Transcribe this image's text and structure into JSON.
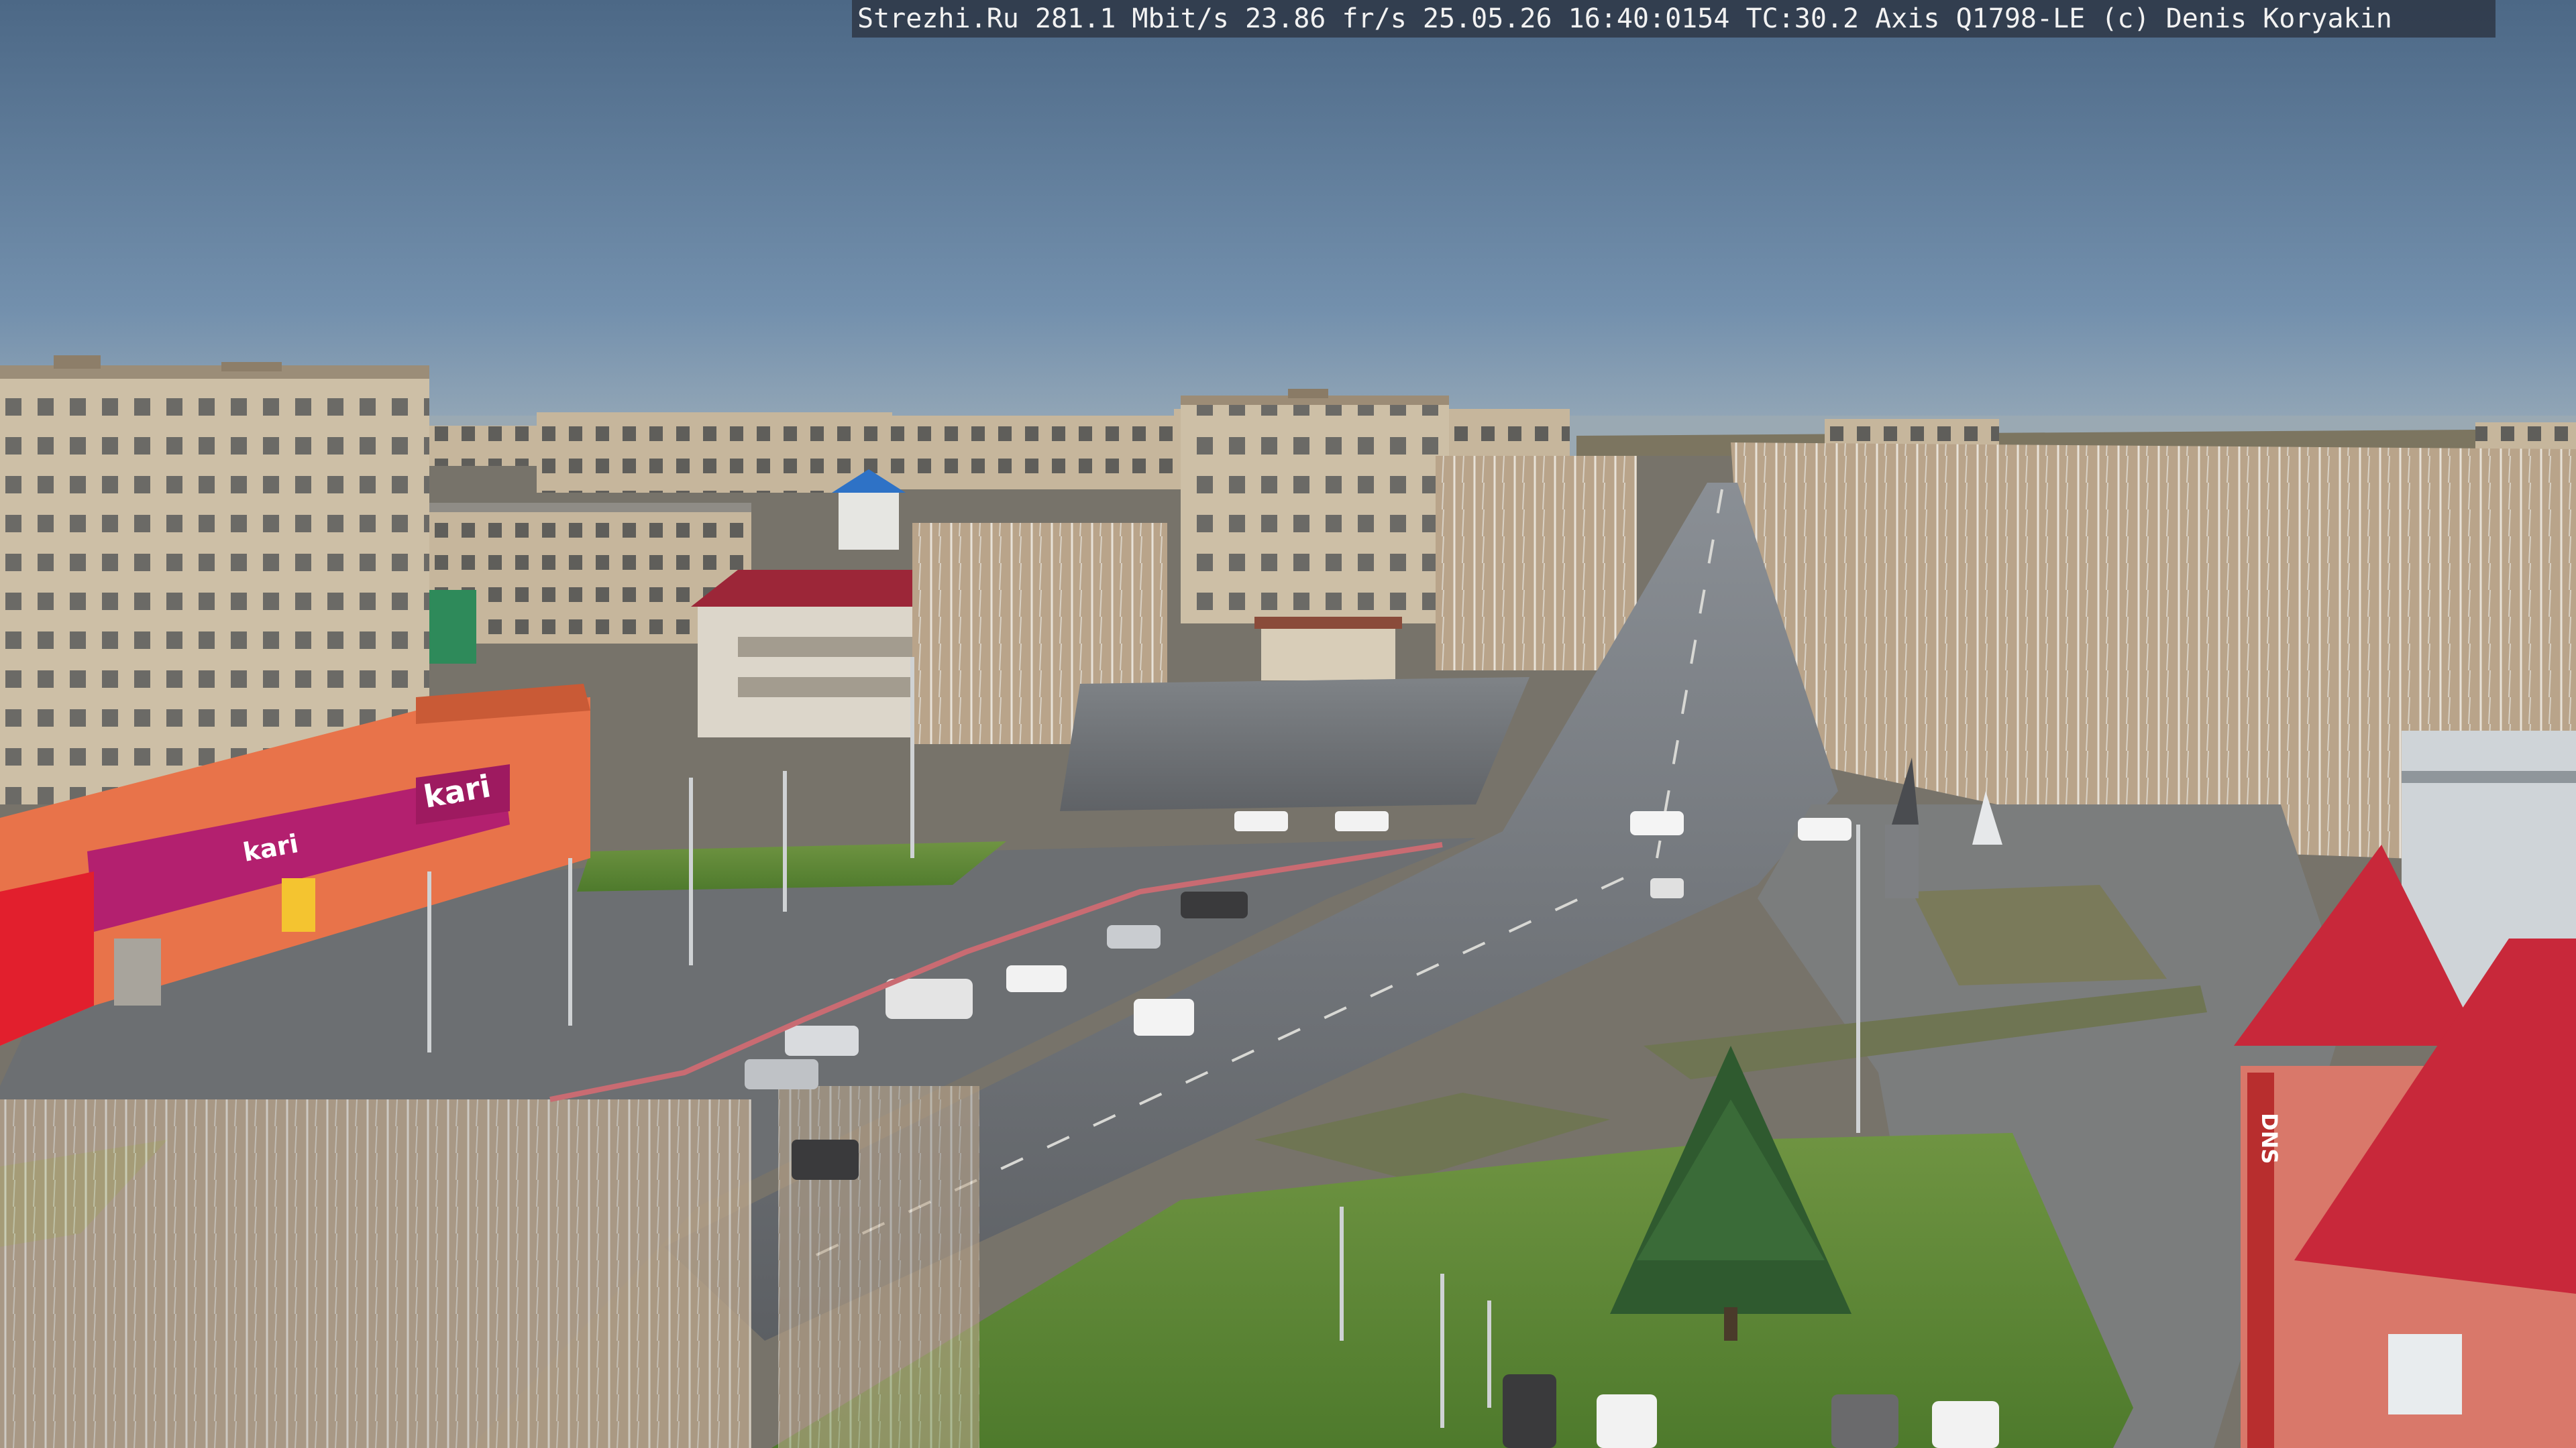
{
  "camera_overlay": {
    "text": "Strezhi.Ru 281.1 Mbit/s 23.86 fr/s 25.05.26 16:40:0154 TC:30.2  Axis Q1798-LE  (c) Denis Koryakin"
  },
  "storefront_signs": {
    "kari_logo": "kari",
    "kari_banner": "kari",
    "dns_sign": "DNS"
  },
  "colors": {
    "sky_top": "#4f6b8a",
    "sky_bottom": "#7d98b4",
    "horizon": "#98a8b4",
    "asphalt": "#6a6d70",
    "grass": "#5f8a3a",
    "store_orange": "#e8734a",
    "store_magenta": "#b3206f",
    "roof_red": "#c8283a"
  }
}
